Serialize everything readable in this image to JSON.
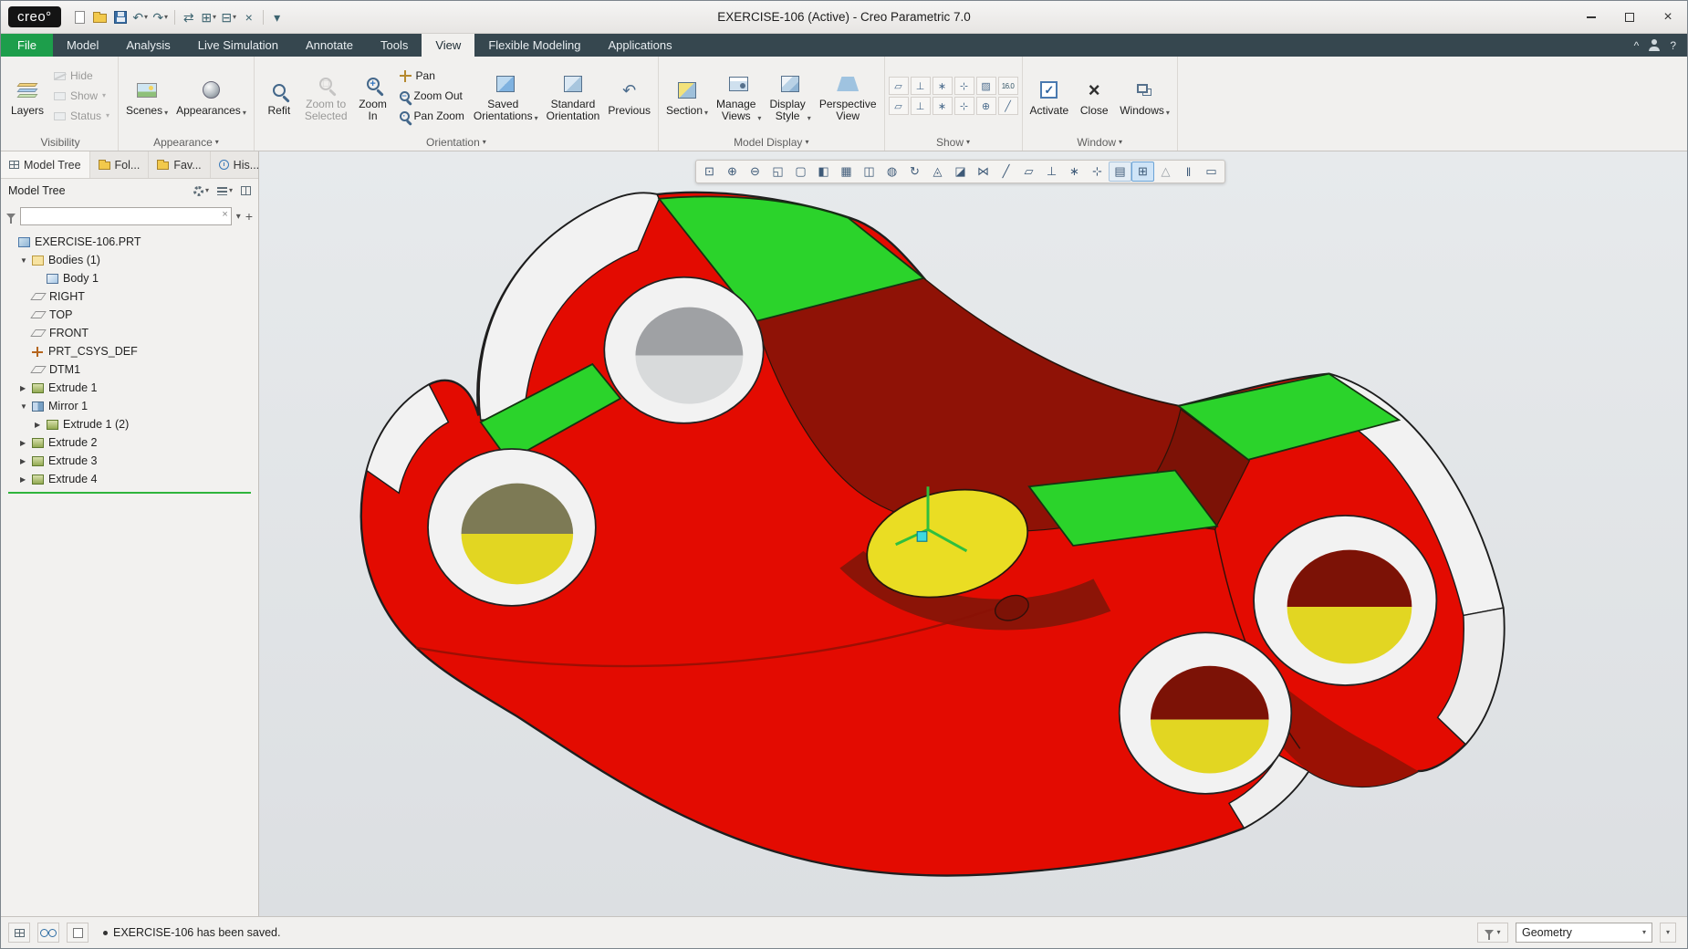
{
  "window": {
    "logo_text": "creo°",
    "title": "EXERCISE-106 (Active) - Creo Parametric 7.0"
  },
  "quick_access": {
    "items": [
      {
        "name": "new-file",
        "glyph": ""
      },
      {
        "name": "open",
        "glyph": ""
      },
      {
        "name": "save",
        "glyph": ""
      },
      {
        "name": "undo",
        "glyph": "↶"
      },
      {
        "name": "redo",
        "glyph": "↷"
      },
      {
        "name": "regenerate",
        "glyph": "⇄"
      },
      {
        "name": "new-window",
        "glyph": "⊞"
      },
      {
        "name": "windows",
        "glyph": "⊟"
      },
      {
        "name": "close-window",
        "glyph": "×"
      },
      {
        "name": "customize",
        "glyph": "▾"
      }
    ]
  },
  "menu_tabs": {
    "active": "View",
    "collapse_glyph": "^",
    "help_glyph": "?",
    "items": [
      {
        "label": "File"
      },
      {
        "label": "Model"
      },
      {
        "label": "Analysis"
      },
      {
        "label": "Live Simulation"
      },
      {
        "label": "Annotate"
      },
      {
        "label": "Tools"
      },
      {
        "label": "View"
      },
      {
        "label": "Flexible Modeling"
      },
      {
        "label": "Applications"
      }
    ]
  },
  "ribbon": {
    "visibility": {
      "label": "Visibility",
      "layers": "Layers",
      "hide": "Hide",
      "show": "Show",
      "status": "Status"
    },
    "appearance": {
      "label": "Appearance",
      "scenes": "Scenes",
      "appearances": "Appearances"
    },
    "orientation": {
      "label": "Orientation",
      "refit": "Refit",
      "zoom_to_selected": "Zoom to\nSelected",
      "zoom_in": "Zoom\nIn",
      "pan": "Pan",
      "zoom_out": "Zoom Out",
      "pan_zoom": "Pan Zoom",
      "saved_orientations": "Saved\nOrientations",
      "standard_orientation": "Standard\nOrientation",
      "previous": "Previous",
      "previous_glyph": "↶"
    },
    "model_display": {
      "label": "Model Display",
      "section": "Section",
      "manage_views": "Manage\nViews",
      "display_style": "Display\nStyle",
      "perspective_view": "Perspective\nView"
    },
    "show": {
      "label": "Show",
      "icons": [
        {
          "name": "plane-display",
          "glyph": "▱"
        },
        {
          "name": "axis-display",
          "glyph": "⊥"
        },
        {
          "name": "point-display",
          "glyph": "∗"
        },
        {
          "name": "csys-display",
          "glyph": "⊹"
        },
        {
          "name": "annotation-display",
          "glyph": "▨"
        },
        {
          "name": "dim-display",
          "glyph": "16.0"
        },
        {
          "name": "plane-tag-display",
          "glyph": "▱"
        },
        {
          "name": "axis-tag-display",
          "glyph": "⊥"
        },
        {
          "name": "point-tag-display",
          "glyph": "∗"
        },
        {
          "name": "csys-tag-display",
          "glyph": "⊹"
        },
        {
          "name": "spin-center-display",
          "glyph": "⊕"
        },
        {
          "name": "sketcher-display",
          "glyph": "╱"
        }
      ]
    },
    "window_group": {
      "label": "Window",
      "activate": "Activate",
      "activate_glyph": "✓",
      "close": "Close",
      "close_glyph": "×",
      "windows": "Windows"
    }
  },
  "navigator": {
    "tabs": [
      {
        "label": "Model Tree"
      },
      {
        "label": "Fol..."
      },
      {
        "label": "Fav..."
      },
      {
        "label": "His..."
      }
    ],
    "header": "Model Tree",
    "filter_value": "",
    "clear_glyph": "×",
    "add_glyph": "+",
    "tree": [
      {
        "label": "EXERCISE-106.PRT",
        "icon": "part",
        "exp": ""
      },
      {
        "label": "Bodies (1)",
        "icon": "bodies-folder",
        "exp": "▼"
      },
      {
        "label": "Body 1",
        "icon": "body",
        "exp": ""
      },
      {
        "label": "RIGHT",
        "icon": "datum-plane",
        "exp": ""
      },
      {
        "label": "TOP",
        "icon": "datum-plane",
        "exp": ""
      },
      {
        "label": "FRONT",
        "icon": "datum-plane",
        "exp": ""
      },
      {
        "label": "PRT_CSYS_DEF",
        "icon": "csys",
        "exp": ""
      },
      {
        "label": "DTM1",
        "icon": "datum-plane",
        "exp": ""
      },
      {
        "label": "Extrude 1",
        "icon": "extrude",
        "exp": "▶"
      },
      {
        "label": "Mirror 1",
        "icon": "mirror",
        "exp": "▼"
      },
      {
        "label": "Extrude 1 (2)",
        "icon": "extrude",
        "exp": "▶"
      },
      {
        "label": "Extrude 2",
        "icon": "extrude",
        "exp": "▶"
      },
      {
        "label": "Extrude 3",
        "icon": "extrude",
        "exp": "▶"
      },
      {
        "label": "Extrude 4",
        "icon": "extrude",
        "exp": "▶"
      }
    ]
  },
  "graphics": {
    "toolbar": {
      "icons": [
        {
          "name": "zoom-region",
          "glyph": "⊡",
          "active": false
        },
        {
          "name": "zoom-in",
          "glyph": "⊕",
          "active": false
        },
        {
          "name": "zoom-out",
          "glyph": "⊖",
          "active": false
        },
        {
          "name": "refit",
          "glyph": "◱",
          "active": false
        },
        {
          "name": "repaint",
          "glyph": "▢",
          "active": false
        },
        {
          "name": "shaded-view",
          "glyph": "◧",
          "active": false
        },
        {
          "name": "named-views",
          "glyph": "▦",
          "active": false
        },
        {
          "name": "capture",
          "glyph": "◫",
          "active": false
        },
        {
          "name": "render-style",
          "glyph": "◍",
          "active": false
        },
        {
          "name": "spin-center",
          "glyph": "↻",
          "active": false
        },
        {
          "name": "perspective",
          "glyph": "◬",
          "active": false
        },
        {
          "name": "section-view",
          "glyph": "◪",
          "active": false
        },
        {
          "name": "explode",
          "glyph": "⋈",
          "active": false
        },
        {
          "name": "sketch-display",
          "glyph": "╱",
          "active": false
        },
        {
          "name": "datum-plane-toggle",
          "glyph": "▱",
          "active": false
        },
        {
          "name": "datum-axis-toggle",
          "glyph": "⊥",
          "active": false
        },
        {
          "name": "datum-point-toggle",
          "glyph": "∗",
          "active": false
        },
        {
          "name": "datum-csys-toggle",
          "glyph": "⊹",
          "active": false
        },
        {
          "name": "annotation-toggle",
          "glyph": "▤",
          "active": true
        },
        {
          "name": "3d-dragger",
          "glyph": "⊞",
          "active": true
        },
        {
          "name": "warning",
          "glyph": "△",
          "active": false
        },
        {
          "name": "pause",
          "glyph": "‖",
          "active": false
        },
        {
          "name": "stop",
          "glyph": "▭",
          "active": false
        }
      ]
    }
  },
  "statusbar": {
    "message": "EXERCISE-106 has been saved.",
    "selection_filter": "Geometry"
  },
  "colors": {
    "file_tab_green": "#1d9e4b",
    "tab_bar": "#36474f",
    "model_red": "#e30b01",
    "model_dark_red": "#8f1206",
    "model_green": "#2bd32b",
    "model_yellow": "#eadd23",
    "highlight_blue": "#cfe4f7",
    "insert_line_green": "#2fb43c"
  }
}
